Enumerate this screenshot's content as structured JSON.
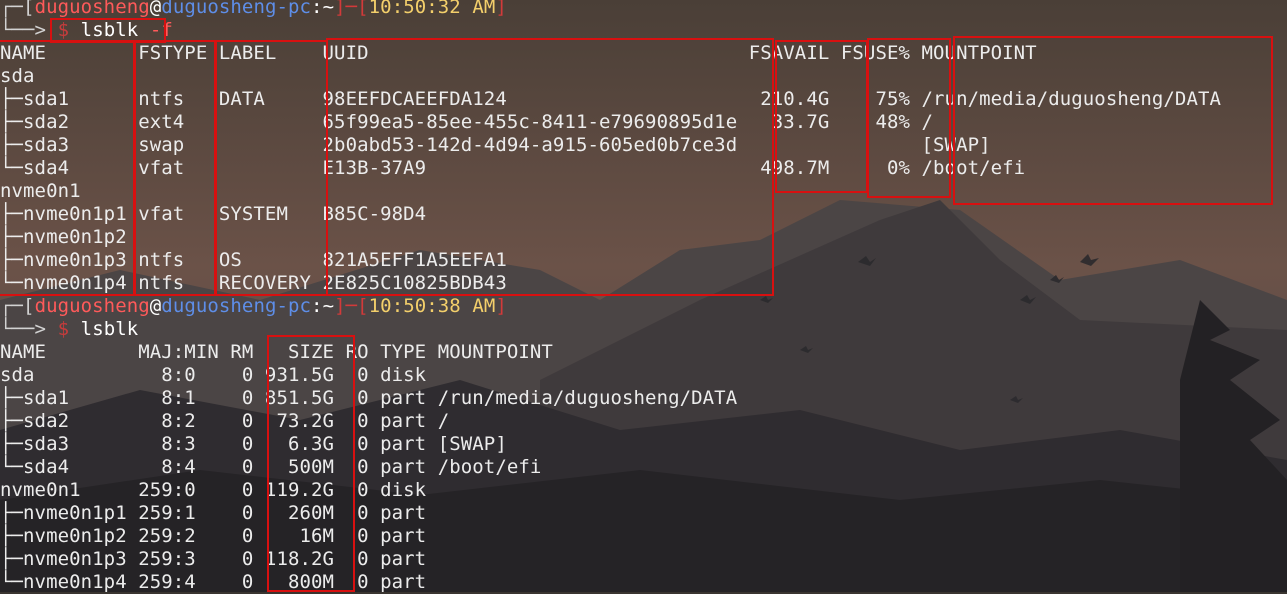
{
  "prompt1": {
    "frame_top": "┌─[",
    "user": "duguosheng",
    "at": "@",
    "host": "duguosheng-pc",
    "sep": ":~",
    "close_bracket": "]─[",
    "time": "10:50:32 AM",
    "end_bracket": "]",
    "frame_bottom": "└──> ",
    "dollar": "$",
    "command": "lsblk",
    "flag": "-f"
  },
  "lsblk_f": {
    "header": "NAME        FSTYPE LABEL    UUID                                 FSAVAIL FSUSE% MOUNTPOINT",
    "rows": [
      "sda                                                                                 ",
      "├─sda1      ntfs   DATA     98EEFDCAEEFDA124                      210.4G    75% /run/media/duguosheng/DATA",
      "├─sda2      ext4            65f99ea5-85ee-455c-8411-e79690895d1e   33.7G    48% /",
      "├─sda3      swap            2b0abd53-142d-4d94-a915-605ed0b7ce3d                [SWAP]",
      "└─sda4      vfat            E13B-37A9                             498.7M     0% /boot/efi",
      "nvme0n1                                                                             ",
      "├─nvme0n1p1 vfat   SYSTEM   B85C-98D4                                           ",
      "├─nvme0n1p2                                                                         ",
      "├─nvme0n1p3 ntfs   OS       821A5EFF1A5EEFA1                                    ",
      "└─nvme0n1p4 ntfs   RECOVERY 2E825C10825BDB43                                    "
    ]
  },
  "prompt2": {
    "frame_top": "┌─[",
    "user": "duguosheng",
    "at": "@",
    "host": "duguosheng-pc",
    "sep": ":~",
    "close_bracket": "]─[",
    "time": "10:50:38 AM",
    "end_bracket": "]",
    "frame_bottom": "└──> ",
    "dollar": "$",
    "command": "lsblk"
  },
  "lsblk": {
    "header": "NAME        MAJ:MIN RM   SIZE RO TYPE MOUNTPOINT",
    "rows": [
      "sda           8:0    0 931.5G  0 disk ",
      "├─sda1        8:1    0 851.5G  0 part /run/media/duguosheng/DATA",
      "├─sda2        8:2    0  73.2G  0 part /",
      "├─sda3        8:3    0   6.3G  0 part [SWAP]",
      "└─sda4        8:4    0   500M  0 part /boot/efi",
      "nvme0n1     259:0    0 119.2G  0 disk ",
      "├─nvme0n1p1 259:1    0   260M  0 part ",
      "├─nvme0n1p2 259:2    0    16M  0 part ",
      "├─nvme0n1p3 259:3    0 118.2G  0 part ",
      "└─nvme0n1p4 259:4    0   800M  0 part "
    ]
  },
  "colors": {
    "highlight": "#d81010",
    "text": "#ececec",
    "user": "#ff5a5a",
    "host": "#5e8ee8",
    "time": "#f3cf6b"
  }
}
